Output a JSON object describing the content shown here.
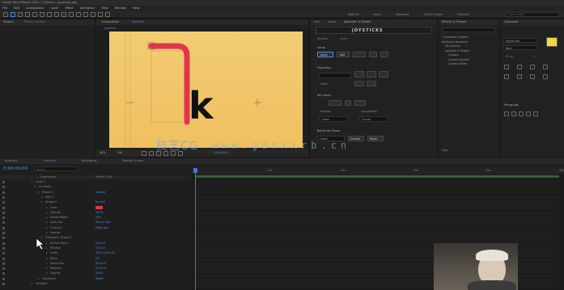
{
  "title_bar": {
    "title": "Adobe After Effects 2020 - C:\\Users\\...\\joysticks.aep"
  },
  "menu": [
    "File",
    "Edit",
    "Composition",
    "Layer",
    "Effect",
    "Animation",
    "View",
    "Window",
    "Help"
  ],
  "workspaces": [
    "Default",
    "Learn",
    "Standard",
    "Small Screen",
    "Libraries"
  ],
  "search_placeholder": "Search Help",
  "project_panel": {
    "tab": "Project",
    "tab2": "Effect Controls"
  },
  "comp_panel": {
    "tab": "Composition",
    "comp_name": "Joysticks",
    "zoom": "50%",
    "quality": "Full",
    "timecode": "0;00;00;00",
    "glyph_letter": "k"
  },
  "joysticks_panel": {
    "tabs": [
      "Info",
      "Audio",
      "Joysticks 'n Sliders"
    ],
    "title": "JOYSTICKS",
    "tab_joystick": "Joystick",
    "tab_slider": "Slider",
    "section_setup": "Setup",
    "section_properties": "Properties",
    "section_key_poses": "Key Poses",
    "section_bounds": "Bounds",
    "buttons": [
      "Apply",
      "Add",
      "Key Poses",
      "Load",
      "Save"
    ],
    "row_labels": [
      "Mode",
      "Weights",
      "Interpolation",
      "Reset"
    ],
    "dropdown_values": [
      "Linear",
      "Curves"
    ],
    "footer_label": "Below Key Poses",
    "footer_values": [
      "Linear",
      "Smooth",
      "Reset"
    ]
  },
  "effects_panel": {
    "tab": "Effects & Presets",
    "items": [
      "* Animation Presets",
      "Keyframe Assistant",
      "3D Channel",
      "Joysticks & Sliders",
      "Custom",
      "Custom Joystick",
      "Custom Slider"
    ],
    "footer": "Align"
  },
  "right_panel": {
    "tab": "Character",
    "font": "Myriad Pro",
    "style": "Bold",
    "size": "55 px",
    "tracking": "0",
    "paragraph_tab": "Paragraph"
  },
  "timeline": {
    "tabs": [
      "Joysticks",
      "Controls",
      "Keyframes",
      "Render Queue"
    ],
    "timecode": "0;00;00;00",
    "search_placeholder": "Search",
    "column_header": "Layer Name",
    "parent_header": "Parent & Link",
    "ruler": [
      "0s",
      "01s",
      "02s",
      "03s",
      "04s",
      "05s"
    ],
    "layers": [
      {
        "label": "Layer 1",
        "value": ""
      },
      {
        "label": "Contents",
        "value": ""
      },
      {
        "label": "Shape 1",
        "value": "Normal"
      },
      {
        "label": "Path 1",
        "value": ""
      },
      {
        "label": "Stroke 1",
        "value": "Normal"
      },
      {
        "label": "Color",
        "value": ""
      },
      {
        "label": "Opacity",
        "value": "100%"
      },
      {
        "label": "Stroke Width",
        "value": "16.0"
      },
      {
        "label": "Line Cap",
        "value": "Round Cap"
      },
      {
        "label": "Line Join",
        "value": "Miter Join"
      },
      {
        "label": "Dashes",
        "value": ""
      },
      {
        "label": "Transform: Shape 1",
        "value": ""
      },
      {
        "label": "Anchor Point",
        "value": "0.0,0.0"
      },
      {
        "label": "Position",
        "value": "0.0,0.0"
      },
      {
        "label": "Scale",
        "value": "100.0,100.0%"
      },
      {
        "label": "Skew",
        "value": "0.0"
      },
      {
        "label": "Skew Axis",
        "value": "0x+0.0°"
      },
      {
        "label": "Rotation",
        "value": "0x+0.0°"
      },
      {
        "label": "Opacity",
        "value": "100%"
      },
      {
        "label": "Transform",
        "value": "Reset"
      },
      {
        "label": "Controls",
        "value": ""
      }
    ]
  },
  "watermark": "www.gdnxxrb.cn",
  "watermark_logo": "技艺CG",
  "colors": {
    "canvas": "#f0c565",
    "stroke": "#e0354f",
    "accent": "#4e8fdc",
    "playhead": "#3d78d8"
  }
}
